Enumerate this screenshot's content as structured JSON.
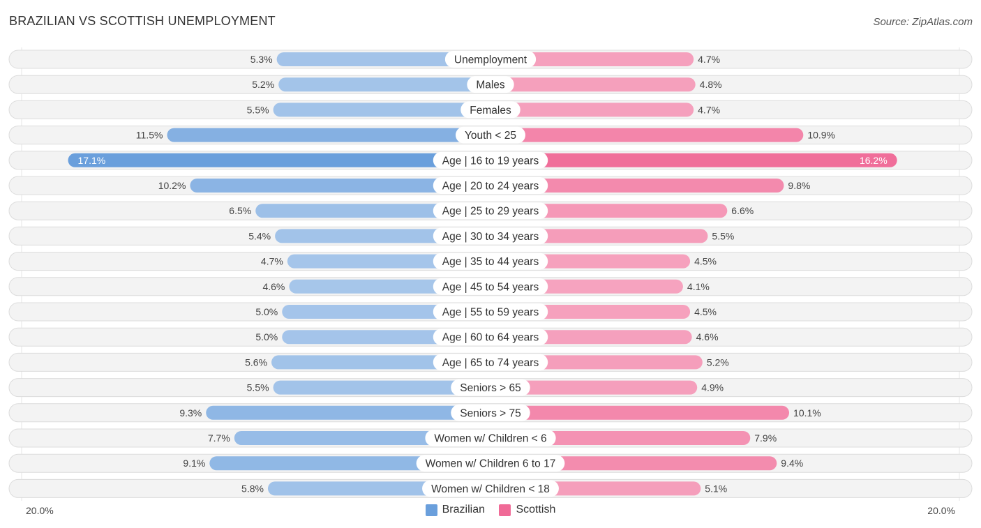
{
  "header": {
    "title": "BRAZILIAN VS SCOTTISH UNEMPLOYMENT",
    "source": "Source: ZipAtlas.com"
  },
  "axis": {
    "left_label": "20.0%",
    "right_label": "20.0%"
  },
  "legend": [
    {
      "name": "Brazilian",
      "color": "#6a9fdc"
    },
    {
      "name": "Scottish",
      "color": "#f06a97"
    }
  ],
  "chart_data": {
    "type": "bar",
    "orientation": "horizontal-diverging",
    "title": "BRAZILIAN VS SCOTTISH UNEMPLOYMENT",
    "xlabel": "",
    "ylabel": "",
    "xlim": [
      0,
      20
    ],
    "tick_labels": [
      "20.0%",
      "20.0%"
    ],
    "legend_position": "bottom-center",
    "unit": "%",
    "categories": [
      "Unemployment",
      "Males",
      "Females",
      "Youth < 25",
      "Age | 16 to 19 years",
      "Age | 20 to 24 years",
      "Age | 25 to 29 years",
      "Age | 30 to 34 years",
      "Age | 35 to 44 years",
      "Age | 45 to 54 years",
      "Age | 55 to 59 years",
      "Age | 60 to 64 years",
      "Age | 65 to 74 years",
      "Seniors > 65",
      "Seniors > 75",
      "Women w/ Children < 6",
      "Women w/ Children 6 to 17",
      "Women w/ Children < 18"
    ],
    "series": [
      {
        "name": "Brazilian",
        "color": "#6a9fdc",
        "values": [
          5.3,
          5.2,
          5.5,
          11.5,
          17.1,
          10.2,
          6.5,
          5.4,
          4.7,
          4.6,
          5.0,
          5.0,
          5.6,
          5.5,
          9.3,
          7.7,
          9.1,
          5.8
        ]
      },
      {
        "name": "Scottish",
        "color": "#f06a97",
        "values": [
          4.7,
          4.8,
          4.7,
          10.9,
          16.2,
          9.8,
          6.6,
          5.5,
          4.5,
          4.1,
          4.5,
          4.6,
          5.2,
          4.9,
          10.1,
          7.9,
          9.4,
          5.1
        ]
      }
    ],
    "value_labels": {
      "Brazilian": [
        "5.3%",
        "5.2%",
        "5.5%",
        "11.5%",
        "17.1%",
        "10.2%",
        "6.5%",
        "5.4%",
        "4.7%",
        "4.6%",
        "5.0%",
        "5.0%",
        "5.6%",
        "5.5%",
        "9.3%",
        "7.7%",
        "9.1%",
        "5.8%"
      ],
      "Scottish": [
        "4.7%",
        "4.8%",
        "4.7%",
        "10.9%",
        "16.2%",
        "9.8%",
        "6.6%",
        "5.5%",
        "4.5%",
        "4.1%",
        "4.5%",
        "4.6%",
        "5.2%",
        "4.9%",
        "10.1%",
        "7.9%",
        "9.4%",
        "5.1%"
      ]
    }
  }
}
